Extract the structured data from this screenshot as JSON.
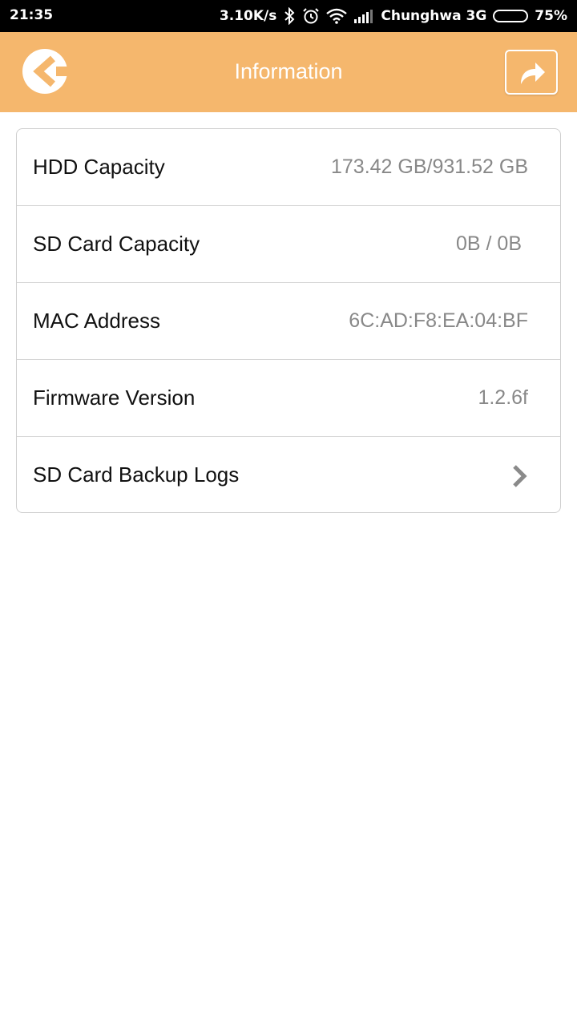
{
  "status_bar": {
    "time": "21:35",
    "network_speed": "3.10K/s",
    "carrier": "Chunghwa 3G",
    "battery_percent": "75%",
    "battery_level": 0.75,
    "icons": [
      "bluetooth-icon",
      "alarm-icon",
      "wifi-icon",
      "signal-icon",
      "battery-icon"
    ]
  },
  "header": {
    "title": "Information",
    "background_color": "#f5b76d",
    "back_icon": "back-arrow-circle-icon",
    "share_icon": "share-arrow-icon"
  },
  "info": {
    "hdd_capacity": {
      "label": "HDD Capacity",
      "value": "173.42 GB/931.52 GB"
    },
    "sd_card_capacity": {
      "label": "SD Card Capacity",
      "value": "0B / 0B"
    },
    "mac_address": {
      "label": "MAC Address",
      "value": "6C:AD:F8:EA:04:BF"
    },
    "firmware_version": {
      "label": "Firmware Version",
      "value": "1.2.6f"
    },
    "sd_card_backup_logs": {
      "label": "SD Card Backup Logs",
      "icon": "chevron-right-icon"
    }
  }
}
